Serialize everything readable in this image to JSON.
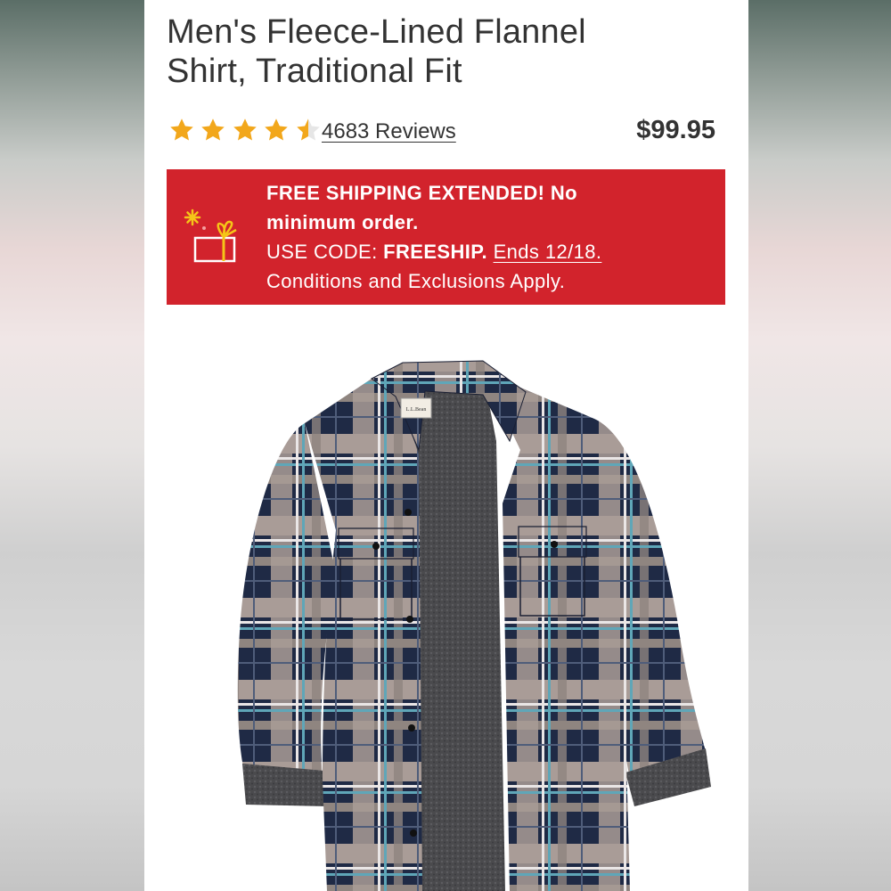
{
  "product": {
    "title_line1": "Men's Fleece-Lined Flannel",
    "title_line2": "Shirt, Traditional Fit",
    "rating": 4.5,
    "reviews_label": "4683 Reviews",
    "price": "$99.95"
  },
  "promo": {
    "headline_line1": "FREE SHIPPING EXTENDED! No",
    "headline_line2": "minimum order.",
    "code_prefix": "USE CODE: ",
    "code": "FREESHIP.",
    "ends": "Ends 12/18.",
    "conditions": "Conditions and Exclusions Apply.",
    "icon": "gift-icon",
    "background_color": "#d2232c"
  },
  "colors": {
    "star": "#f2a71b",
    "text": "#333333"
  },
  "image": {
    "icon": "flannel-shirt-image",
    "label_tag": "L.L.Bean"
  }
}
